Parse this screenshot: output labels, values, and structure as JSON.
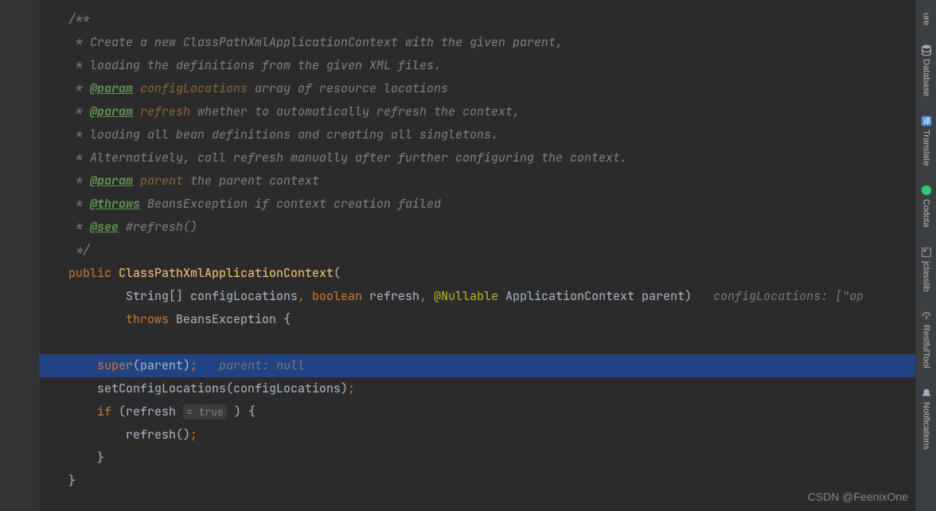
{
  "code": {
    "l1": "    /**",
    "l2_a": "     * ",
    "l2_b": "Create a new ClassPathXmlApplicationContext with the given parent,",
    "l3_a": "     * ",
    "l3_b": "loading the definitions from the given XML files.",
    "l4_a": "     * ",
    "l4_tag": "@param",
    "l4_pn": " configLocations",
    "l4_b": " array of resource locations",
    "l5_a": "     * ",
    "l5_tag": "@param",
    "l5_pn": " refresh",
    "l5_b": " whether to automatically refresh the context,",
    "l6_a": "     * ",
    "l6_b": "loading all bean definitions and creating all singletons.",
    "l7_a": "     * ",
    "l7_b": "Alternatively, call refresh manually after further configuring the context.",
    "l8_a": "     * ",
    "l8_tag": "@param",
    "l8_pn": " parent",
    "l8_b": " the parent context",
    "l9_a": "     * ",
    "l9_tag": "@throws",
    "l9_b": " BeansException ",
    "l9_c": "if context creation failed",
    "l10_a": "     * ",
    "l10_tag": "@see",
    "l10_b": " #refresh()",
    "l11": "     */",
    "l12_a": "    ",
    "l12_kw": "public ",
    "l12_name": "ClassPathXmlApplicationContext",
    "l12_paren": "(",
    "l13_a": "            String[] configLocations",
    "l13_c1": ", ",
    "l13_kw1": "boolean ",
    "l13_v1": "refresh",
    "l13_c2": ", ",
    "l13_ann": "@Nullable ",
    "l13_v2": "ApplicationContext parent)",
    "l13_hint": "   configLocations: [\"ap",
    "l14_a": "            ",
    "l14_kw": "throws ",
    "l14_b": "BeansException {",
    "l15_a": "        ",
    "l15_kw": "super",
    "l15_b": "(parent)",
    "l15_sc": ";",
    "l15_hint": "   parent: null",
    "l16_a": "        setConfigLocations(configLocations)",
    "l16_sc": ";",
    "l17_a": "        ",
    "l17_kw": "if ",
    "l17_b": "(refresh ",
    "l17_hint": "= true",
    "l17_c": " ) {",
    "l18_a": "            refresh()",
    "l18_sc": ";",
    "l19": "        }",
    "l20": "    }"
  },
  "tools": {
    "t0": "ure",
    "t1": "Database",
    "t2": "Translate",
    "t3": "Codota",
    "t4": "jclasslib",
    "t5": "RestfulTool",
    "t6": "Notifications"
  },
  "watermark": "CSDN @FeenixOne"
}
